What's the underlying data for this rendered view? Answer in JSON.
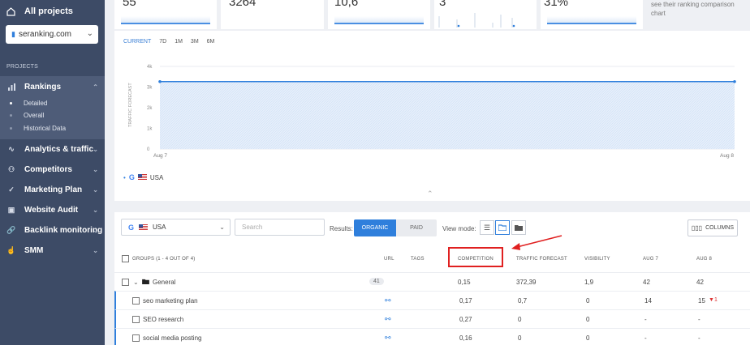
{
  "sidebar": {
    "all_projects": "All projects",
    "site": "seranking.com",
    "section_label": "PROJECTS",
    "items": [
      {
        "label": "Rankings",
        "icon": "bar-chart-icon"
      },
      {
        "label": "Analytics & traffic",
        "icon": "pulse-icon"
      },
      {
        "label": "Competitors",
        "icon": "people-icon"
      },
      {
        "label": "Marketing Plan",
        "icon": "checklist-icon"
      },
      {
        "label": "Website Audit",
        "icon": "audit-icon"
      },
      {
        "label": "Backlink monitoring",
        "icon": "link-icon"
      },
      {
        "label": "SMM",
        "icon": "thumbs-up-icon"
      }
    ],
    "rankings_sub": [
      "Detailed",
      "Overall",
      "Historical Data"
    ]
  },
  "stats": {
    "card1": "55",
    "card2": "3264",
    "card3": "10,6",
    "card4": "3",
    "card5": "31%",
    "side_text_line1": "see their ranking comparison",
    "side_text_line2": "chart"
  },
  "chart": {
    "periods": [
      "CURRENT",
      "7D",
      "1M",
      "3M",
      "6M"
    ],
    "ylabel": "TRAFFIC FORECAST",
    "y_ticks": [
      "4k",
      "3k",
      "2k",
      "1k",
      "0"
    ],
    "x_ticks": [
      "Aug 7",
      "Aug 8"
    ],
    "legend_country": "USA",
    "line_color": "#2f7fdc"
  },
  "chart_data": {
    "type": "area",
    "x": [
      "Aug 7",
      "Aug 8"
    ],
    "series": [
      {
        "values": [
          3264,
          3264
        ]
      }
    ],
    "ylabel": "TRAFFIC FORECAST",
    "ylim": [
      0,
      4000
    ]
  },
  "toolbar": {
    "country": "USA",
    "search_placeholder": "Search",
    "results_label": "Results:",
    "organic": "ORGANIC",
    "paid": "PAID",
    "view_mode_label": "View mode:",
    "columns": "COLUMNS"
  },
  "table": {
    "headers": {
      "groups": "GROUPS (1 - 4 OUT OF 4)",
      "url": "URL",
      "tags": "TAGS",
      "competition": "COMPETITION",
      "traffic": "TRAFFIC FORECAST",
      "visibility": "VISIBILITY",
      "aug7": "AUG 7",
      "aug8": "AUG 8"
    },
    "group": {
      "name": "General",
      "count": "41",
      "competition": "0,15",
      "traffic": "372,39",
      "visibility": "1,9",
      "aug7": "42",
      "aug8": "42"
    },
    "rows": [
      {
        "keyword": "seo marketing plan",
        "competition": "0,17",
        "traffic": "0,7",
        "visibility": "0",
        "aug7": "14",
        "aug8": "15",
        "delta": "1"
      },
      {
        "keyword": "SEO research",
        "competition": "0,27",
        "traffic": "0",
        "visibility": "0",
        "aug7": "-",
        "aug8": "-",
        "delta": ""
      },
      {
        "keyword": "social media posting",
        "competition": "0,16",
        "traffic": "0",
        "visibility": "0",
        "aug7": "-",
        "aug8": "-",
        "delta": ""
      }
    ]
  }
}
